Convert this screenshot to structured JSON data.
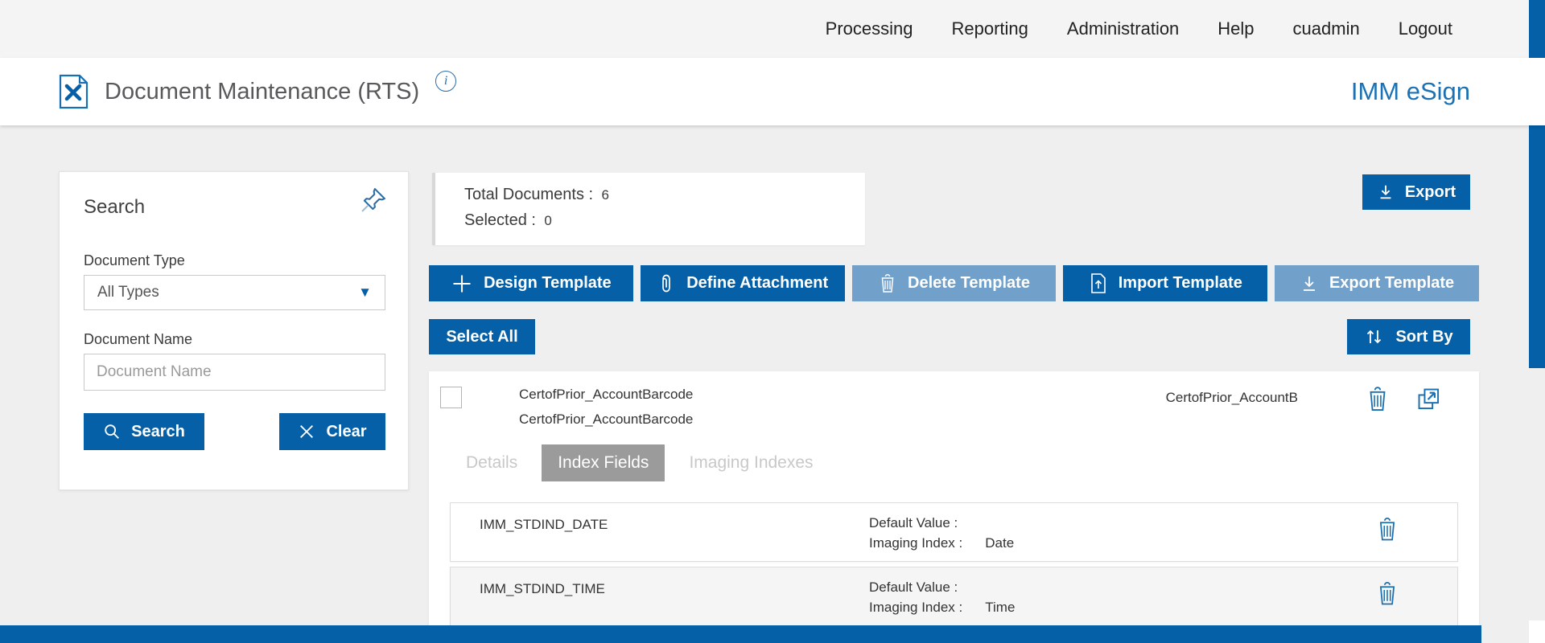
{
  "colors": {
    "primary": "#0560a8",
    "disabled_button": "#71a0ca",
    "brand_text": "#1a72b4",
    "tab_active_bg": "#9b9b9b",
    "icon_blue": "#1a6fb0"
  },
  "top_nav": {
    "items": [
      "Processing",
      "Reporting",
      "Administration",
      "Help",
      "cuadmin",
      "Logout"
    ]
  },
  "header": {
    "title": "Document Maintenance (RTS)",
    "info_icon": "i",
    "brand": "IMM eSign"
  },
  "search_panel": {
    "title": "Search",
    "document_type_label": "Document Type",
    "document_type_value": "All Types",
    "document_name_label": "Document Name",
    "document_name_placeholder": "Document Name",
    "search_button": "Search",
    "clear_button": "Clear"
  },
  "summary": {
    "total_label": "Total Documents :",
    "total_value": "6",
    "selected_label": "Selected :",
    "selected_value": "0"
  },
  "export_button": "Export",
  "toolbar": {
    "buttons": [
      {
        "label": "Design Template",
        "icon": "plus-icon",
        "enabled": true
      },
      {
        "label": "Define Attachment",
        "icon": "paperclip-icon",
        "enabled": true
      },
      {
        "label": "Delete Template",
        "icon": "trash-icon",
        "enabled": false
      },
      {
        "label": "Import Template",
        "icon": "import-icon",
        "enabled": true
      },
      {
        "label": "Export Template",
        "icon": "download-icon",
        "enabled": false
      }
    ]
  },
  "select_all_button": "Select All",
  "sort_by_button": "Sort By",
  "document": {
    "name_line1": "CertofPrior_AccountBarcode",
    "name_line2": "CertofPrior_AccountBarcode",
    "right_name": "CertofPrior_AccountB"
  },
  "tabs": [
    {
      "label": "Details",
      "active": false
    },
    {
      "label": "Index Fields",
      "active": true
    },
    {
      "label": "Imaging Indexes",
      "active": false
    }
  ],
  "index_fields": [
    {
      "name": "IMM_STDIND_DATE",
      "default_value_label": "Default Value :",
      "default_value": "",
      "imaging_index_label": "Imaging Index :",
      "imaging_index_value": "Date"
    },
    {
      "name": "IMM_STDIND_TIME",
      "default_value_label": "Default Value :",
      "default_value": "",
      "imaging_index_label": "Imaging Index :",
      "imaging_index_value": "Time"
    }
  ],
  "icons": {
    "header": "document-tools-icon",
    "pin": "pin-icon",
    "dropdown": "chevron-down-icon",
    "search": "search-icon",
    "clear": "close-icon",
    "export": "download-icon",
    "sort": "sort-arrows-icon",
    "row_delete": "trash-icon",
    "row_open": "open-external-icon"
  }
}
